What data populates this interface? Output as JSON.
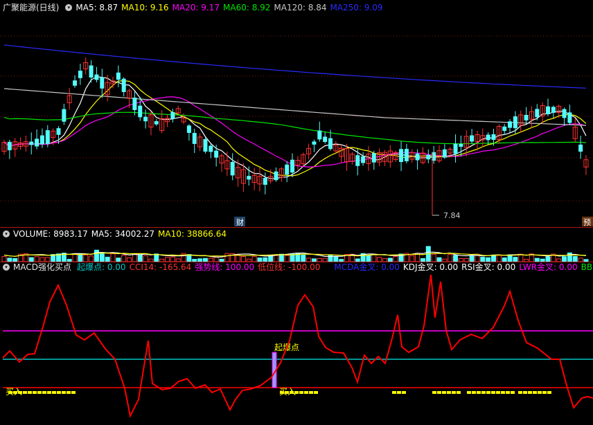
{
  "price_header": {
    "title": "广聚能源(日线)",
    "ma5": "MA5: 8.87",
    "ma10": "MA10: 9.16",
    "ma20": "MA20: 9.17",
    "ma60": "MA60: 8.92",
    "ma120": "MA120: 8.84",
    "ma250": "MA250: 9.09"
  },
  "price_annotations": {
    "low_label": "7.84",
    "finance_marker": "财",
    "forecast_marker": "预"
  },
  "volume_header": {
    "volume": "VOLUME: 8983.17",
    "ma5": "MA5: 34002.27",
    "ma10": "MA10: 38866.64"
  },
  "indicator_header": {
    "name": "MACD强化买点",
    "qbd": "起爆点: 0.00",
    "cci": "CCI14: -165.64",
    "qsx": "强势线: 100.00",
    "dwx": "低位线: -100.00",
    "mcda": "MCDA金叉: 0.00",
    "kdj": "KDJ金叉: 0.00",
    "rsi": "RSI金叉: 0.00",
    "lwr": "LWR金叉: 0.00",
    "bbi": "BBI金叉"
  },
  "indicator_annotations": {
    "signal_label": "起爆点",
    "buy_label_1": "买入",
    "buy_label_2": "买入"
  },
  "colors": {
    "background": "#000000",
    "up": "#ff3232",
    "down": "#54fcfc",
    "ma5": "#ffffff",
    "ma10": "#ffff00",
    "ma20": "#ff00ff",
    "ma60": "#00e600",
    "ma120": "#c8c8c8",
    "ma250": "#2a2aff",
    "cci_line": "#ff0000",
    "strong_line": "#ff00ff",
    "low_line": "#00c8c8",
    "signal": "#ffff00"
  }
}
